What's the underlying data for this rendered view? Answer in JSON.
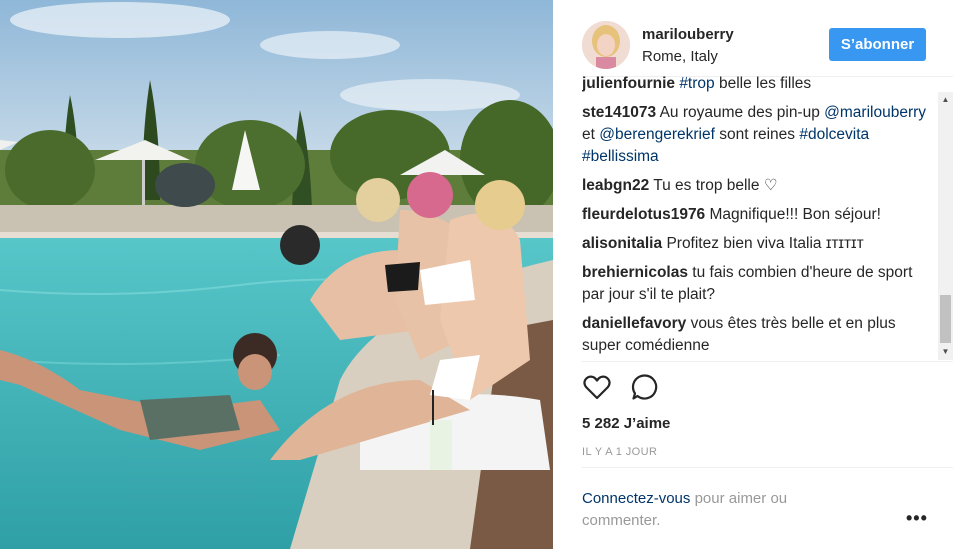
{
  "post": {
    "username": "marilouberry",
    "location": "Rome, Italy",
    "follow_label": "S’abonner"
  },
  "comments": [
    {
      "user": "julienfournie",
      "parts": [
        {
          "text": "#trop",
          "tag": true
        },
        {
          "text": " belle les filles",
          "tag": false
        }
      ]
    },
    {
      "user": "ste141073",
      "parts": [
        {
          "text": "Au royaume des pin-up ",
          "tag": false
        },
        {
          "text": "@marilouberry",
          "tag": true
        },
        {
          "text": " et ",
          "tag": false
        },
        {
          "text": "@berengerekrief",
          "tag": true
        },
        {
          "text": " sont reines ",
          "tag": false
        },
        {
          "text": "#dolcevita",
          "tag": true
        },
        {
          "text": " ",
          "tag": false
        },
        {
          "text": "#bellissima",
          "tag": true
        }
      ]
    },
    {
      "user": "leabgn22",
      "parts": [
        {
          "text": "Tu es trop belle ♡",
          "tag": false
        }
      ]
    },
    {
      "user": "fleurdelotus1976",
      "parts": [
        {
          "text": "Magnifique!!! Bon séjour!",
          "tag": false
        }
      ]
    },
    {
      "user": "alisonitalia",
      "parts": [
        {
          "text": "Profitez bien viva Italia ɪᴛɪᴛɪᴛ",
          "tag": false
        }
      ]
    },
    {
      "user": "brehiernicolas",
      "parts": [
        {
          "text": "tu fais combien d'heure de sport par jour s'il te plait?",
          "tag": false
        }
      ]
    },
    {
      "user": "daniellefavory",
      "parts": [
        {
          "text": "vous êtes très belle et en plus super comédienne",
          "tag": false
        }
      ]
    }
  ],
  "likes": "5 282 J’aime",
  "timestamp": "IL Y A 1 JOUR",
  "login": {
    "link": "Connectez-vous",
    "rest": " pour aimer ou commenter."
  },
  "icons": {
    "like": "heart-icon",
    "comment": "comment-bubble-icon",
    "more": "more-options-icon"
  },
  "colors": {
    "accent": "#3897f0",
    "link": "#003569",
    "muted": "#999999"
  }
}
